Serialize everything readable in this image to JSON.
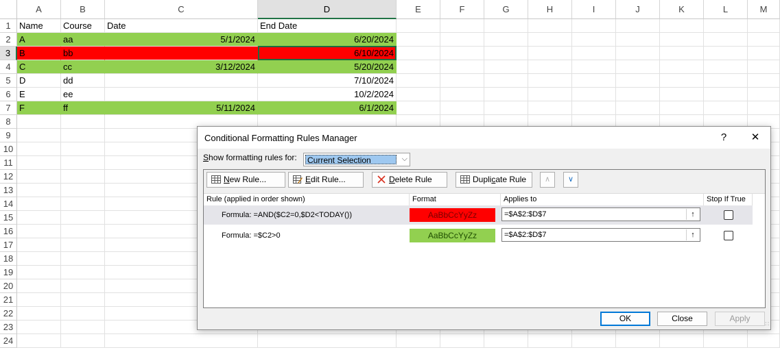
{
  "columns": [
    "A",
    "B",
    "C",
    "D",
    "E",
    "F",
    "G",
    "H",
    "I",
    "J",
    "K",
    "L",
    "M"
  ],
  "rows": [
    "1",
    "2",
    "3",
    "4",
    "5",
    "6",
    "7",
    "8",
    "9",
    "10",
    "11",
    "12",
    "13",
    "14",
    "15",
    "16",
    "17",
    "18",
    "19",
    "20",
    "21",
    "22",
    "23",
    "24"
  ],
  "selected_column": "D",
  "selected_row": "3",
  "cells": {
    "header": {
      "a": "Name",
      "b": "Course",
      "c": "Date",
      "d": "End Date"
    },
    "data": [
      {
        "a": "A",
        "b": "aa",
        "c": "5/1/2024",
        "d": "6/20/2024",
        "fill": "#92d050"
      },
      {
        "a": "B",
        "b": "bb",
        "c": "",
        "d": "6/10/2024",
        "fill": "#ff0000"
      },
      {
        "a": "C",
        "b": "cc",
        "c": "3/12/2024",
        "d": "5/20/2024",
        "fill": "#92d050"
      },
      {
        "a": "D",
        "b": "dd",
        "c": "",
        "d": "7/10/2024",
        "fill": ""
      },
      {
        "a": "E",
        "b": "ee",
        "c": "",
        "d": "10/2/2024",
        "fill": ""
      },
      {
        "a": "F",
        "b": "ff",
        "c": "5/11/2024",
        "d": "6/1/2024",
        "fill": "#92d050"
      }
    ]
  },
  "dialog": {
    "title": "Conditional Formatting Rules Manager",
    "help_label": "?",
    "close_label": "✕",
    "show_label_key": "S",
    "show_label_rest": "how formatting rules for:",
    "show_value": "Current Selection",
    "toolbar": {
      "new_rule_key": "N",
      "new_rule_rest": "ew Rule...",
      "edit_rule_key": "E",
      "edit_rule_rest": "dit Rule...",
      "delete_rule_key": "D",
      "delete_rule_rest": "elete Rule",
      "duplicate_rule_pre": "Dupli",
      "duplicate_rule_key": "c",
      "duplicate_rule_rest": "ate Rule"
    },
    "headers": {
      "rule": "Rule (applied in order shown)",
      "format": "Format",
      "applies": "Applies to",
      "stop": "Stop If True"
    },
    "rules": [
      {
        "formula": "Formula: =AND($C2=0,$D2<TODAY())",
        "preview": "AaBbCcYyZz",
        "preview_bg": "#ff0000",
        "preview_color": "#7a0000",
        "applies_to": "=$A$2:$D$7",
        "stop": false
      },
      {
        "formula": "Formula: =$C2>0",
        "preview": "AaBbCcYyZz",
        "preview_bg": "#92d050",
        "preview_color": "#1f4d00",
        "applies_to": "=$A$2:$D$7",
        "stop": false
      }
    ],
    "ok_label": "OK",
    "close_button_label": "Close",
    "apply_label": "Apply"
  }
}
